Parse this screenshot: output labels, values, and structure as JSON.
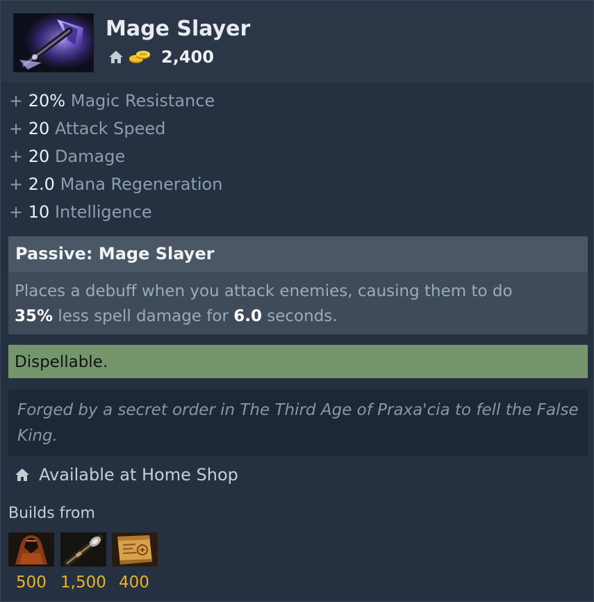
{
  "item": {
    "name": "Mage Slayer",
    "cost": "2,400",
    "icon": "mage-slayer-item-icon",
    "shop_icon": "home-icon",
    "gold_icon": "gold-coins-icon"
  },
  "stats": [
    {
      "prefix": "+",
      "value": "20%",
      "label": "Magic Resistance"
    },
    {
      "prefix": "+",
      "value": "20",
      "label": "Attack Speed"
    },
    {
      "prefix": "+",
      "value": "20",
      "label": "Damage"
    },
    {
      "prefix": "+",
      "value": "2.0",
      "label": "Mana Regeneration"
    },
    {
      "prefix": "+",
      "value": "10",
      "label": "Intelligence"
    }
  ],
  "passive": {
    "title": "Passive: Mage Slayer",
    "text_1": "Places a debuff when you attack enemies, causing them to do",
    "value_1": "35%",
    "text_2": "less spell damage for",
    "value_2": "6.0",
    "text_3": "seconds."
  },
  "dispel": "Dispellable.",
  "lore": "Forged by a secret order in The Third Age of Praxa'cia to fell the False King.",
  "availability": "Available at Home Shop",
  "builds": {
    "label": "Builds from",
    "components": [
      {
        "icon": "cloak-icon",
        "cost": "500"
      },
      {
        "icon": "staff-icon",
        "cost": "1,500"
      },
      {
        "icon": "recipe-scroll-icon",
        "cost": "400"
      }
    ]
  },
  "colors": {
    "background": "#253040",
    "header": "#2b3646",
    "passive_header": "#4b5765",
    "passive_body": "#3f4b59",
    "dispel": "#75956c",
    "lore": "#1e2834",
    "gold": "#e7b526"
  }
}
